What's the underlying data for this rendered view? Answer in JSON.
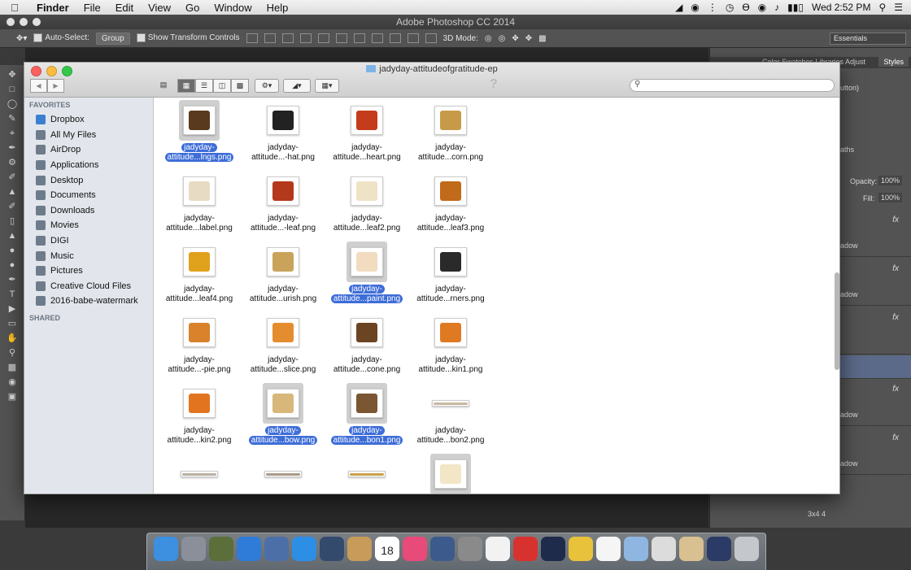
{
  "menubar": {
    "app": "Finder",
    "items": [
      "File",
      "Edit",
      "View",
      "Go",
      "Window",
      "Help"
    ],
    "clock": "Wed 2:52 PM"
  },
  "photoshop": {
    "title": "Adobe Photoshop CC 2014",
    "auto_select_label": "Auto-Select:",
    "auto_select_value": "Group",
    "show_transform": "Show Transform Controls",
    "mode_3d": "3D Mode:",
    "workspace": "Essentials",
    "panel_tab_styles": "Styles",
    "panel_tabs_partial": "Color  Swatches  Libraries  Adjust",
    "button_partial": "utton)",
    "paths_partial": "aths",
    "opacity_label": "Opacity:",
    "opacity_value": "100%",
    "fill_label": "Fill:",
    "fill_value": "100%",
    "fx": "fx",
    "shadow_partial": "adow",
    "layer_name_partial": "3x4 4"
  },
  "finder": {
    "title": "jadyday-attitudeofgratitude-ep",
    "search_placeholder": "",
    "help": "?",
    "sidebar": {
      "favorites_header": "FAVORITES",
      "shared_header": "SHARED",
      "items": [
        {
          "label": "Dropbox",
          "icon": "dropbox-icon",
          "color": "#3b7fd0"
        },
        {
          "label": "All My Files",
          "icon": "all-files-icon",
          "color": "#6e7b8b"
        },
        {
          "label": "AirDrop",
          "icon": "airdrop-icon",
          "color": "#6e7b8b"
        },
        {
          "label": "Applications",
          "icon": "applications-icon",
          "color": "#6e7b8b"
        },
        {
          "label": "Desktop",
          "icon": "desktop-icon",
          "color": "#6e7b8b"
        },
        {
          "label": "Documents",
          "icon": "documents-icon",
          "color": "#6e7b8b"
        },
        {
          "label": "Downloads",
          "icon": "downloads-icon",
          "color": "#6e7b8b"
        },
        {
          "label": "Movies",
          "icon": "movies-icon",
          "color": "#6e7b8b"
        },
        {
          "label": "DIGI",
          "icon": "folder-icon",
          "color": "#6e7b8b"
        },
        {
          "label": "Music",
          "icon": "music-icon",
          "color": "#6e7b8b"
        },
        {
          "label": "Pictures",
          "icon": "pictures-icon",
          "color": "#6e7b8b"
        },
        {
          "label": "Creative Cloud Files",
          "icon": "creative-cloud-icon",
          "color": "#6e7b8b"
        },
        {
          "label": "2016-babe-watermark",
          "icon": "folder-icon",
          "color": "#6e7b8b"
        }
      ]
    },
    "files": [
      {
        "l1": "jadyday-",
        "l2": "attitude...lngs.png",
        "sel": true,
        "thumb": "#5a3a1e"
      },
      {
        "l1": "jadyday-",
        "l2": "attitude...-hat.png",
        "sel": false,
        "thumb": "#222222"
      },
      {
        "l1": "jadyday-",
        "l2": "attitude...heart.png",
        "sel": false,
        "thumb": "#c43c1c"
      },
      {
        "l1": "jadyday-",
        "l2": "attitude...corn.png",
        "sel": false,
        "thumb": "#c79a4a"
      },
      {
        "l1": "jadyday-",
        "l2": "attitude...label.png",
        "sel": false,
        "thumb": "#e7dcc3"
      },
      {
        "l1": "jadyday-",
        "l2": "attitude...-leaf.png",
        "sel": false,
        "thumb": "#b4381c"
      },
      {
        "l1": "jadyday-",
        "l2": "attitude...leaf2.png",
        "sel": false,
        "thumb": "#efe3c6"
      },
      {
        "l1": "jadyday-",
        "l2": "attitude...leaf3.png",
        "sel": false,
        "thumb": "#c06a1a"
      },
      {
        "l1": "jadyday-",
        "l2": "attitude...leaf4.png",
        "sel": false,
        "thumb": "#e0a21c"
      },
      {
        "l1": "jadyday-",
        "l2": "attitude...urish.png",
        "sel": false,
        "thumb": "#c9a35a"
      },
      {
        "l1": "jadyday-",
        "l2": "attitude...paint.png",
        "sel": true,
        "thumb": "#f2dcc0"
      },
      {
        "l1": "jadyday-",
        "l2": "attitude...rners.png",
        "sel": false,
        "thumb": "#2a2a2a"
      },
      {
        "l1": "jadyday-",
        "l2": "attitude...-pie.png",
        "sel": false,
        "thumb": "#d9822b"
      },
      {
        "l1": "jadyday-",
        "l2": "attitude...slice.png",
        "sel": false,
        "thumb": "#e48d2e"
      },
      {
        "l1": "jadyday-",
        "l2": "attitude...cone.png",
        "sel": false,
        "thumb": "#6b4424"
      },
      {
        "l1": "jadyday-",
        "l2": "attitude...kin1.png",
        "sel": false,
        "thumb": "#e07a22"
      },
      {
        "l1": "jadyday-",
        "l2": "attitude...kin2.png",
        "sel": false,
        "thumb": "#e27420"
      },
      {
        "l1": "jadyday-",
        "l2": "attitude...bow.png",
        "sel": true,
        "thumb": "#d7b77a"
      },
      {
        "l1": "jadyday-",
        "l2": "attitude...bon1.png",
        "sel": true,
        "thumb": "#7a5632"
      },
      {
        "l1": "jadyday-",
        "l2": "attitude...bon2.png",
        "sel": false,
        "thumb": "#c9b9a0"
      },
      {
        "l1": "",
        "l2": "",
        "sel": false,
        "thumb": "#b9b0a0"
      },
      {
        "l1": "",
        "l2": "",
        "sel": false,
        "thumb": "#a99a88"
      },
      {
        "l1": "",
        "l2": "",
        "sel": false,
        "thumb": "#c9a048"
      },
      {
        "l1": "",
        "l2": "",
        "sel": true,
        "thumb": "#f2e6c6"
      }
    ]
  },
  "dock": {
    "apps": [
      "finder",
      "launchpad",
      "photo-app",
      "app-store",
      "preview",
      "safari",
      "facetime",
      "contacts",
      "calendar",
      "itunes",
      "iphoto",
      "system-preferences",
      "textedit",
      "creative-cloud",
      "photoshop",
      "chrome",
      "document",
      "folder",
      "spreadsheet",
      "map-image",
      "photoshop-file",
      "trash"
    ],
    "calendar_day": "18"
  }
}
